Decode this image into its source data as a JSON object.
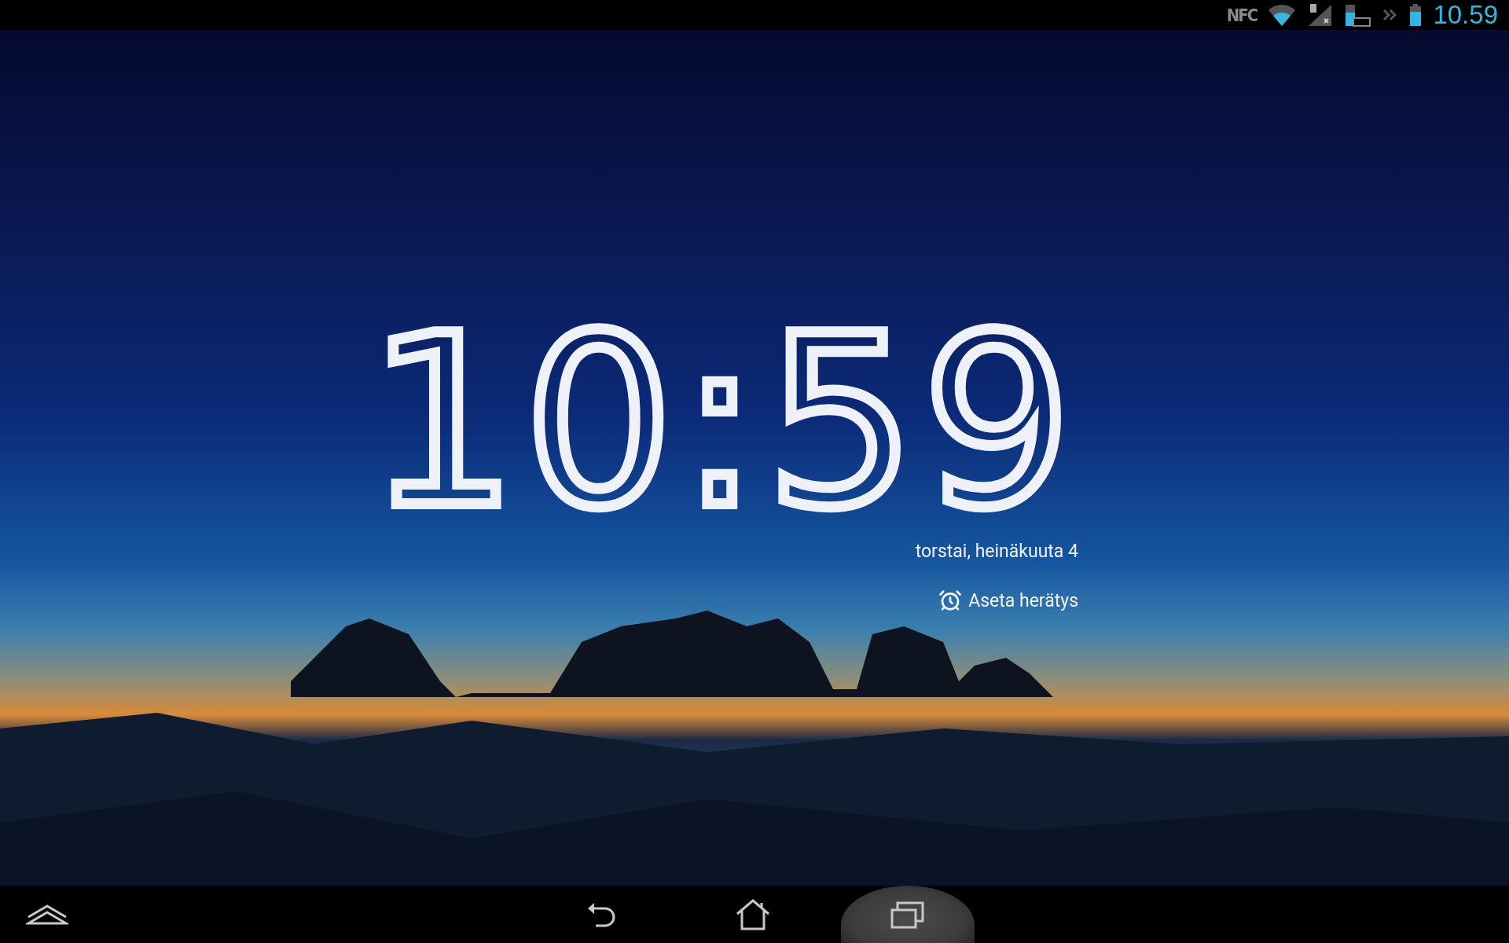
{
  "status_bar": {
    "nfc_label": "NFC",
    "time": "10.59"
  },
  "daydream": {
    "time": "10:59",
    "date": "torstai, heinäkuuta 4",
    "alarm": "Aseta herätys"
  },
  "nav_bar": {
    "buttons": [
      {
        "kind": "up",
        "pressed": false
      },
      {
        "kind": "back",
        "pressed": false
      },
      {
        "kind": "home",
        "pressed": false
      },
      {
        "kind": "recents",
        "pressed": true
      }
    ]
  }
}
